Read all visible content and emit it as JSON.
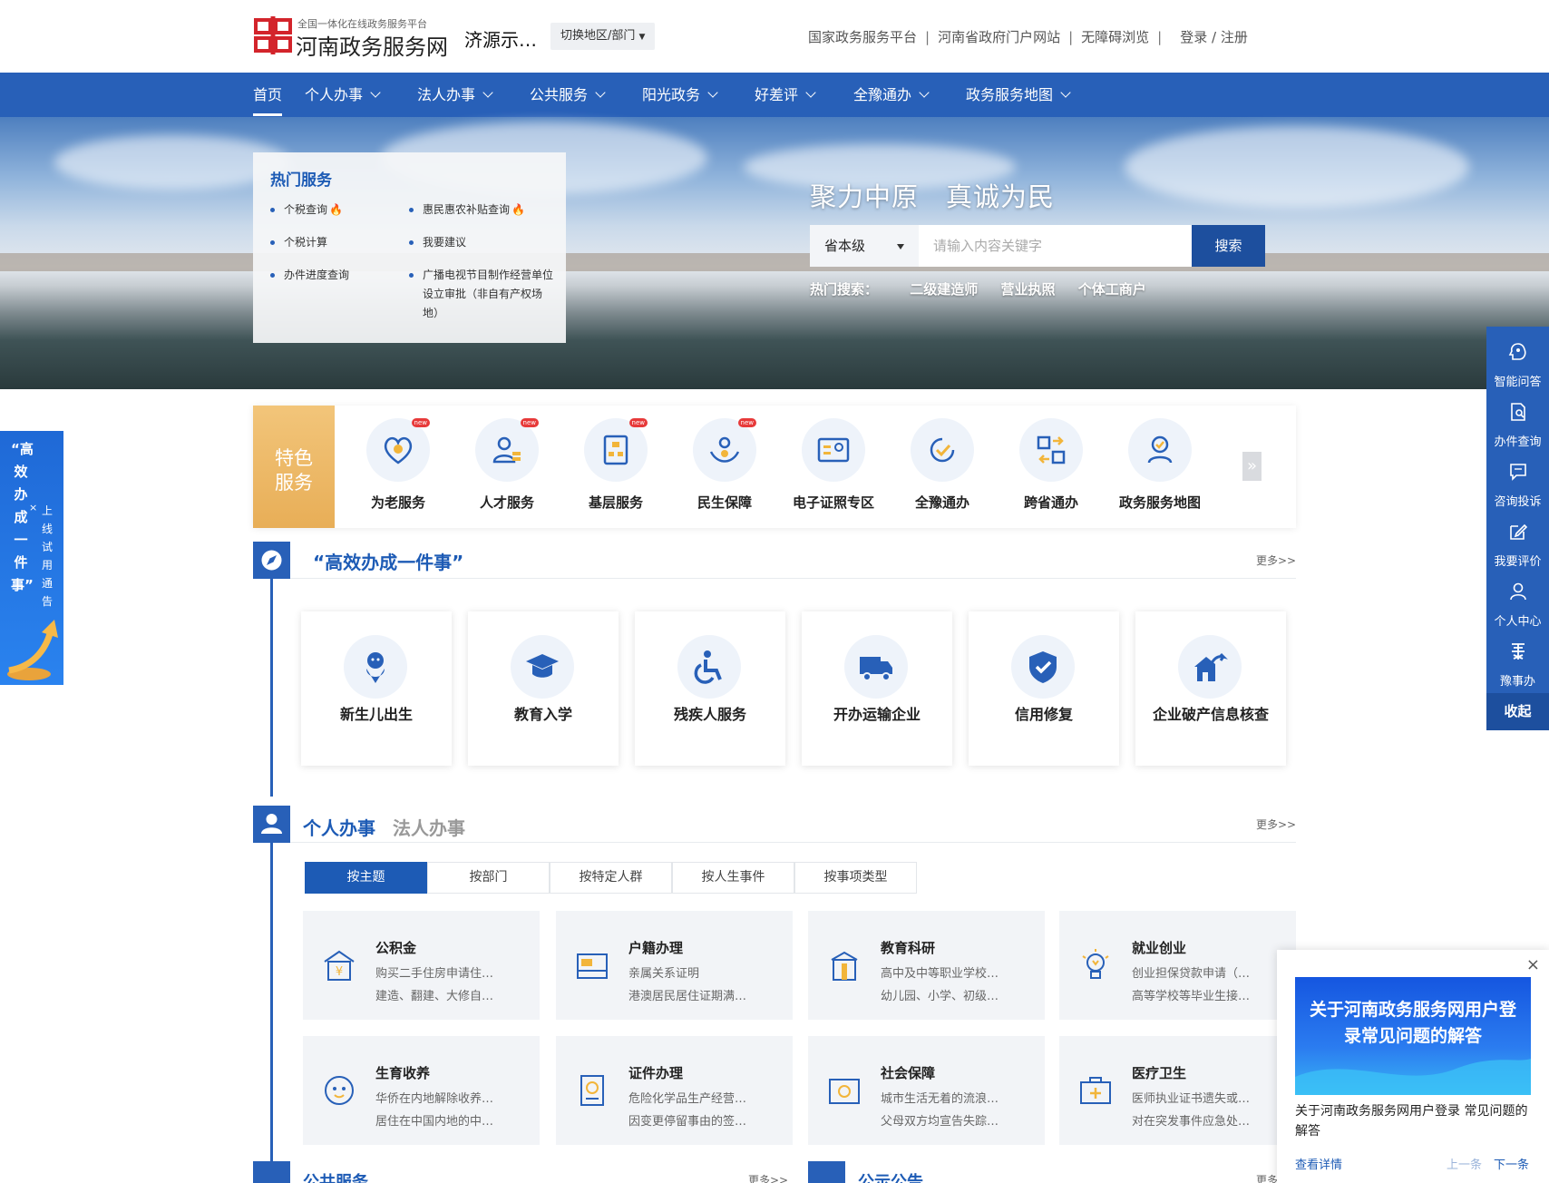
{
  "header": {
    "logo_sub": "全国一体化在线政务服务平台",
    "logo_title": "河南政务服务网",
    "region": "济源示…",
    "switch_label": "切换地区/部门",
    "links": [
      "国家政务服务平台",
      "河南省政府门户网站",
      "无障碍浏览"
    ],
    "login": "登录",
    "register": "注册"
  },
  "nav": {
    "items": [
      "首页",
      "个人办事",
      "法人办事",
      "公共服务",
      "阳光政务",
      "好差评",
      "全豫通办",
      "政务服务地图"
    ]
  },
  "banner": {
    "hot_title": "热门服务",
    "hot_links": [
      "个税查询",
      "惠民惠农补贴查询",
      "个税计算",
      "我要建议",
      "办件进度查询",
      "广播电视节目制作经营单位设立审批（非自有产权场地）"
    ],
    "slogan": "聚力中原　真诚为民",
    "scope": "省本级",
    "search_placeholder": "请输入内容关键字",
    "search_button": "搜索",
    "hot_search_label": "热门搜索：",
    "hot_search": [
      "二级建造师",
      "营业执照",
      "个体工商户"
    ]
  },
  "featured": {
    "label_line1": "特色",
    "label_line2": "服务",
    "new_badge": "new",
    "items": [
      "为老服务",
      "人才服务",
      "基层服务",
      "民生保障",
      "电子证照专区",
      "全豫通办",
      "跨省通办",
      "政务服务地图"
    ],
    "next": "»"
  },
  "gaoxiao": {
    "title": "“高效办成一件事”",
    "more": "更多>>",
    "cards": [
      "新生儿出生",
      "教育入学",
      "残疾人服务",
      "开办运输企业",
      "信用修复",
      "企业破产信息核查"
    ]
  },
  "personal": {
    "tab_personal": "个人办事",
    "tab_legal": "法人办事",
    "more": "更多>>",
    "subtabs": [
      "按主题",
      "按部门",
      "按特定人群",
      "按人生事件",
      "按事项类型"
    ],
    "topics": [
      {
        "title": "公积金",
        "l1": "购买二手住房申请住…",
        "l2": "建造、翻建、大修自…"
      },
      {
        "title": "户籍办理",
        "l1": "亲属关系证明",
        "l2": "港澳居民居住证期满…"
      },
      {
        "title": "教育科研",
        "l1": "高中及中等职业学校…",
        "l2": "幼儿园、小学、初级…"
      },
      {
        "title": "就业创业",
        "l1": "创业担保贷款申请（…",
        "l2": "高等学校等毕业生接…"
      },
      {
        "title": "生育收养",
        "l1": "华侨在内地解除收养…",
        "l2": "居住在中国内地的中…"
      },
      {
        "title": "证件办理",
        "l1": "危险化学品生产经营…",
        "l2": "因变更停留事由的签…"
      },
      {
        "title": "社会保障",
        "l1": "城市生活无着的流浪…",
        "l2": "父母双方均宣告失踪…"
      },
      {
        "title": "医疗卫生",
        "l1": "医师执业证书遗失或…",
        "l2": "对在突发事件应急处…"
      }
    ]
  },
  "bottom": {
    "public": "公共服务",
    "public_more": "更多>>",
    "notice": "公示公告",
    "notice_more": "更多"
  },
  "left_float": {
    "main": "“高效办成一件事”",
    "sub": "上线试用通告",
    "close": "×"
  },
  "right_bar": {
    "items": [
      "智能问答",
      "办件查询",
      "咨询投诉",
      "我要评价",
      "个人中心",
      "豫事办"
    ],
    "collapse": "收起"
  },
  "popup": {
    "close": "×",
    "banner_text": "关于河南政务服务网用户登录常见问题的解答",
    "desc": "关于河南政务服务网用户登录 常见问题的解答",
    "more": "查看详情",
    "prev": "上一条",
    "next": "下一条"
  },
  "colors": {
    "brand": "#2860b8",
    "accent": "#e8ae57",
    "dark_brand": "#1d4f9e"
  }
}
